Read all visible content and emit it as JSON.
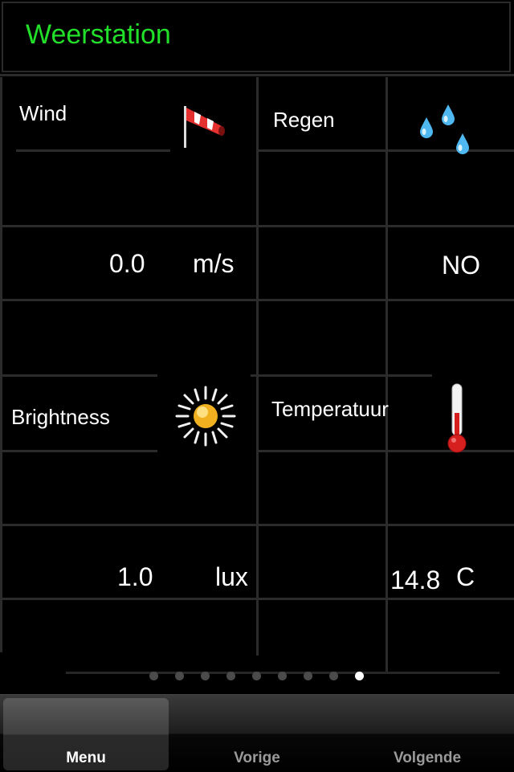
{
  "header": {
    "title": "Weerstation"
  },
  "tiles": {
    "wind": {
      "label": "Wind",
      "value": "0.0",
      "unit": "m/s",
      "icon": "windsock-icon"
    },
    "rain": {
      "label": "Regen",
      "value": "NO",
      "icon": "raindrops-icon"
    },
    "brightness": {
      "label": "Brightness",
      "value": "1.0",
      "unit": "lux",
      "icon": "sun-icon"
    },
    "temperature": {
      "label": "Temperatuur",
      "value": "14.8",
      "unit": "C",
      "icon": "thermometer-icon"
    }
  },
  "pager": {
    "total": 9,
    "current": 9
  },
  "tabbar": {
    "tabs": [
      {
        "label": "Menu",
        "selected": true
      },
      {
        "label": "Vorige",
        "selected": false
      },
      {
        "label": "Volgende",
        "selected": false
      }
    ]
  },
  "colors": {
    "title": "#22e02a",
    "background": "#000000",
    "grid": "#2b2b2b"
  }
}
